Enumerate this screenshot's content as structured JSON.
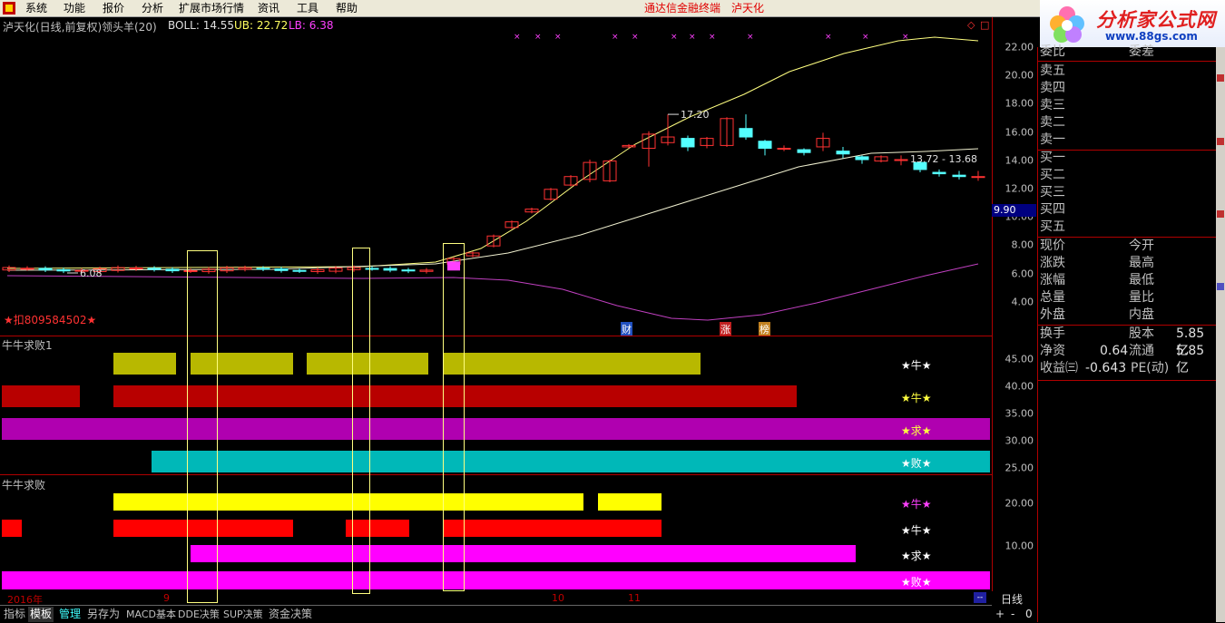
{
  "menu": {
    "items": [
      "系统",
      "功能",
      "报价",
      "分析",
      "扩展市场行情",
      "资讯",
      "工具",
      "帮助"
    ],
    "marquee_left": "通达信金融终端",
    "marquee_right": "泸天化"
  },
  "logo": {
    "text": "分析家公式网",
    "url_text": "www.88gs.com"
  },
  "title": {
    "stock": "泸天化(日线,前复权)",
    "indicator_name": "领头羊(20)",
    "boll": "BOLL: 14.55",
    "ub": "UB: 22.72",
    "lb": "LB: 6.38"
  },
  "main_chart": {
    "price_axis": [
      "22.00",
      "20.00",
      "18.00",
      "16.00",
      "14.00",
      "12.00",
      "10.00",
      "8.00",
      "6.00",
      "4.00"
    ],
    "current_price": "9.90",
    "high_label": "17.20",
    "low_label": "6.08",
    "last_label": "13.72 - 13.68",
    "deduct_text": "★扣809584502★",
    "event_marks": [
      "财",
      "涨",
      "榜"
    ],
    "x_mark": "×"
  },
  "indicator1": {
    "title": "牛牛求败1",
    "axis": [
      "45.00",
      "40.00",
      "35.00",
      "30.00",
      "25.00"
    ],
    "labels": [
      "★牛★",
      "★牛★",
      "★求★",
      "★败★"
    ]
  },
  "indicator2": {
    "title": "牛牛求败",
    "axis": [
      "20.00",
      "10.00"
    ],
    "labels": [
      "★牛★",
      "★牛★",
      "★求★",
      "★败★"
    ]
  },
  "dates": {
    "year": "2016年",
    "m9": "9",
    "m10": "10",
    "m11": "11"
  },
  "bottom_tabs": [
    "指标",
    "模板",
    "管理",
    "另存为",
    "MACD基本",
    "DDE决策",
    "SUP决策",
    "资金决策"
  ],
  "period": "日线",
  "zoom_buttons": [
    "+",
    "-",
    "0"
  ],
  "info_panel": {
    "top_label_left": "委比",
    "top_label_right": "委差",
    "sell": [
      "卖五",
      "卖四",
      "卖三",
      "卖二",
      "卖一"
    ],
    "buy": [
      "买一",
      "买二",
      "买三",
      "买四",
      "买五"
    ],
    "left_col": [
      "现价",
      "涨跌",
      "涨幅",
      "总量",
      "外盘"
    ],
    "right_col": [
      "今开",
      "最高",
      "最低",
      "量比",
      "内盘"
    ],
    "turnover": "换手",
    "equity": "股本",
    "equity_val": "5.85亿",
    "net_assets": "净资",
    "net_assets_val": "0.64",
    "float": "流通",
    "float_val": "5.85亿",
    "eps": "收益㈢",
    "eps_val": "-0.643",
    "pe": "PE(动)"
  },
  "colors": {
    "up": "#ff3232",
    "down": "#54ffff",
    "ma_yellow": "#ffff00",
    "ma_white": "#f0f0d0",
    "ma_purple": "#c040c0"
  }
}
